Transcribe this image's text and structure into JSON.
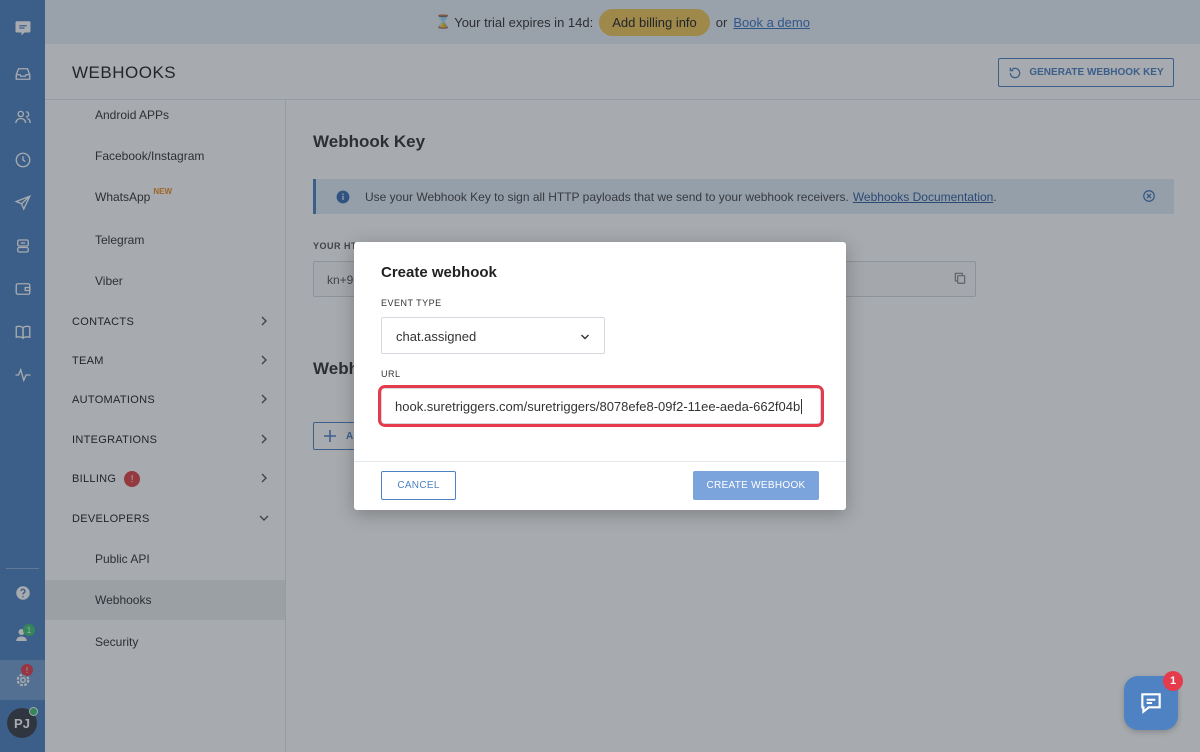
{
  "trial": {
    "hourglass": "⌛",
    "text": "Your trial expires in 14d:",
    "billing_button": "Add billing info",
    "or": "or",
    "demo_link": "Book a demo"
  },
  "header": {
    "title": "WEBHOOKS",
    "generate_button": "GENERATE WEBHOOK KEY"
  },
  "subnav": {
    "channels": [
      "Android APPs",
      "Facebook/Instagram",
      "WhatsApp",
      "Telegram",
      "Viber"
    ],
    "whatsapp_tag": "NEW",
    "sections": [
      "CONTACTS",
      "TEAM",
      "AUTOMATIONS",
      "INTEGRATIONS",
      "BILLING",
      "DEVELOPERS"
    ],
    "billing_badge": "!",
    "developer_items": [
      "Public API",
      "Webhooks",
      "Security"
    ]
  },
  "main": {
    "heading": "Webhook Key",
    "info_text": "Use your Webhook Key to sign all HTTP payloads that we send to your webhook receivers.",
    "info_link": "Webhooks Documentation",
    "info_period": ".",
    "key_label": "YOUR HT",
    "key_value": "kn+9",
    "webhooks_heading": "Webh",
    "add_button": "A"
  },
  "modal": {
    "title": "Create webhook",
    "event_type_label": "EVENT TYPE",
    "event_type_value": "chat.assigned",
    "url_label": "URL",
    "url_value": "hook.suretriggers.com/suretriggers/8078efe8-09f2-11ee-aeda-662f04b",
    "cancel_button": "CANCEL",
    "create_button": "CREATE WEBHOOK"
  },
  "rail": {
    "team_badge": "1",
    "settings_badge": "!",
    "avatar_initials": "PJ"
  },
  "chat": {
    "badge": "1"
  },
  "colors": {
    "brand_blue": "#4e82c3",
    "trial_bg": "#e8f1fb",
    "billing_yellow": "#f0c659",
    "alert_red": "#e43c4d",
    "create_button_bg": "#7ba3dc"
  }
}
